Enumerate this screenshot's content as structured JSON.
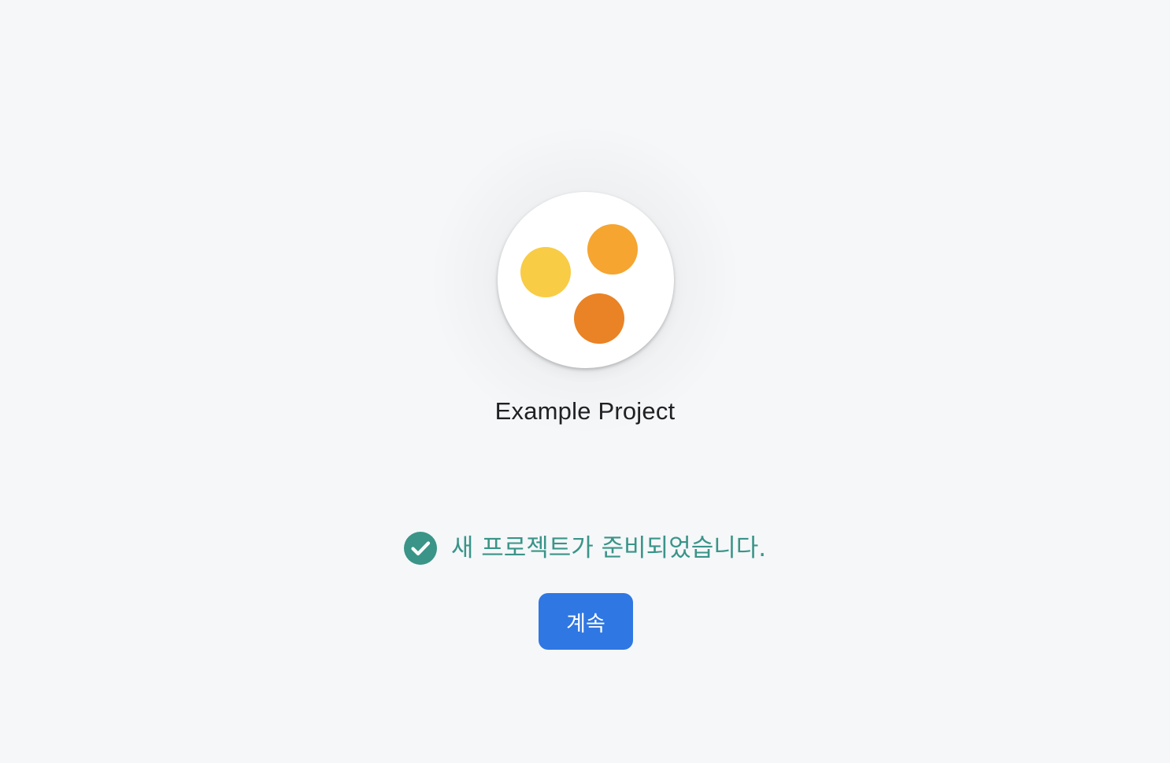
{
  "project": {
    "name": "Example Project",
    "logo_colors": {
      "yellow": "#f8cc45",
      "amber": "#f5a530",
      "orange": "#e98326"
    }
  },
  "status": {
    "icon": "check-circle-icon",
    "text": "새 프로젝트가 준비되었습니다.",
    "color": "#3a9488"
  },
  "actions": {
    "continue_label": "계속",
    "accent": "#2f77e3"
  }
}
